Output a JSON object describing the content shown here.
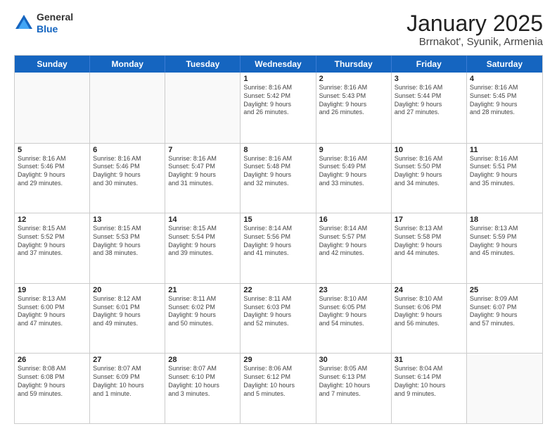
{
  "header": {
    "logo": {
      "line1": "General",
      "line2": "Blue"
    },
    "title": "January 2025",
    "subtitle": "Brrnakot', Syunik, Armenia"
  },
  "weekdays": [
    "Sunday",
    "Monday",
    "Tuesday",
    "Wednesday",
    "Thursday",
    "Friday",
    "Saturday"
  ],
  "weeks": [
    [
      {
        "day": "",
        "info": ""
      },
      {
        "day": "",
        "info": ""
      },
      {
        "day": "",
        "info": ""
      },
      {
        "day": "1",
        "info": "Sunrise: 8:16 AM\nSunset: 5:42 PM\nDaylight: 9 hours\nand 26 minutes."
      },
      {
        "day": "2",
        "info": "Sunrise: 8:16 AM\nSunset: 5:43 PM\nDaylight: 9 hours\nand 26 minutes."
      },
      {
        "day": "3",
        "info": "Sunrise: 8:16 AM\nSunset: 5:44 PM\nDaylight: 9 hours\nand 27 minutes."
      },
      {
        "day": "4",
        "info": "Sunrise: 8:16 AM\nSunset: 5:45 PM\nDaylight: 9 hours\nand 28 minutes."
      }
    ],
    [
      {
        "day": "5",
        "info": "Sunrise: 8:16 AM\nSunset: 5:46 PM\nDaylight: 9 hours\nand 29 minutes."
      },
      {
        "day": "6",
        "info": "Sunrise: 8:16 AM\nSunset: 5:46 PM\nDaylight: 9 hours\nand 30 minutes."
      },
      {
        "day": "7",
        "info": "Sunrise: 8:16 AM\nSunset: 5:47 PM\nDaylight: 9 hours\nand 31 minutes."
      },
      {
        "day": "8",
        "info": "Sunrise: 8:16 AM\nSunset: 5:48 PM\nDaylight: 9 hours\nand 32 minutes."
      },
      {
        "day": "9",
        "info": "Sunrise: 8:16 AM\nSunset: 5:49 PM\nDaylight: 9 hours\nand 33 minutes."
      },
      {
        "day": "10",
        "info": "Sunrise: 8:16 AM\nSunset: 5:50 PM\nDaylight: 9 hours\nand 34 minutes."
      },
      {
        "day": "11",
        "info": "Sunrise: 8:16 AM\nSunset: 5:51 PM\nDaylight: 9 hours\nand 35 minutes."
      }
    ],
    [
      {
        "day": "12",
        "info": "Sunrise: 8:15 AM\nSunset: 5:52 PM\nDaylight: 9 hours\nand 37 minutes."
      },
      {
        "day": "13",
        "info": "Sunrise: 8:15 AM\nSunset: 5:53 PM\nDaylight: 9 hours\nand 38 minutes."
      },
      {
        "day": "14",
        "info": "Sunrise: 8:15 AM\nSunset: 5:54 PM\nDaylight: 9 hours\nand 39 minutes."
      },
      {
        "day": "15",
        "info": "Sunrise: 8:14 AM\nSunset: 5:56 PM\nDaylight: 9 hours\nand 41 minutes."
      },
      {
        "day": "16",
        "info": "Sunrise: 8:14 AM\nSunset: 5:57 PM\nDaylight: 9 hours\nand 42 minutes."
      },
      {
        "day": "17",
        "info": "Sunrise: 8:13 AM\nSunset: 5:58 PM\nDaylight: 9 hours\nand 44 minutes."
      },
      {
        "day": "18",
        "info": "Sunrise: 8:13 AM\nSunset: 5:59 PM\nDaylight: 9 hours\nand 45 minutes."
      }
    ],
    [
      {
        "day": "19",
        "info": "Sunrise: 8:13 AM\nSunset: 6:00 PM\nDaylight: 9 hours\nand 47 minutes."
      },
      {
        "day": "20",
        "info": "Sunrise: 8:12 AM\nSunset: 6:01 PM\nDaylight: 9 hours\nand 49 minutes."
      },
      {
        "day": "21",
        "info": "Sunrise: 8:11 AM\nSunset: 6:02 PM\nDaylight: 9 hours\nand 50 minutes."
      },
      {
        "day": "22",
        "info": "Sunrise: 8:11 AM\nSunset: 6:03 PM\nDaylight: 9 hours\nand 52 minutes."
      },
      {
        "day": "23",
        "info": "Sunrise: 8:10 AM\nSunset: 6:05 PM\nDaylight: 9 hours\nand 54 minutes."
      },
      {
        "day": "24",
        "info": "Sunrise: 8:10 AM\nSunset: 6:06 PM\nDaylight: 9 hours\nand 56 minutes."
      },
      {
        "day": "25",
        "info": "Sunrise: 8:09 AM\nSunset: 6:07 PM\nDaylight: 9 hours\nand 57 minutes."
      }
    ],
    [
      {
        "day": "26",
        "info": "Sunrise: 8:08 AM\nSunset: 6:08 PM\nDaylight: 9 hours\nand 59 minutes."
      },
      {
        "day": "27",
        "info": "Sunrise: 8:07 AM\nSunset: 6:09 PM\nDaylight: 10 hours\nand 1 minute."
      },
      {
        "day": "28",
        "info": "Sunrise: 8:07 AM\nSunset: 6:10 PM\nDaylight: 10 hours\nand 3 minutes."
      },
      {
        "day": "29",
        "info": "Sunrise: 8:06 AM\nSunset: 6:12 PM\nDaylight: 10 hours\nand 5 minutes."
      },
      {
        "day": "30",
        "info": "Sunrise: 8:05 AM\nSunset: 6:13 PM\nDaylight: 10 hours\nand 7 minutes."
      },
      {
        "day": "31",
        "info": "Sunrise: 8:04 AM\nSunset: 6:14 PM\nDaylight: 10 hours\nand 9 minutes."
      },
      {
        "day": "",
        "info": ""
      }
    ]
  ]
}
